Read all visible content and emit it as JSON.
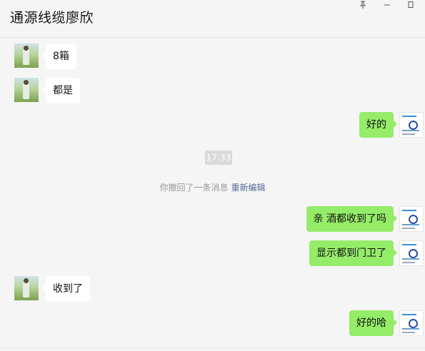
{
  "header": {
    "title": "通源线缆廖欣"
  },
  "window_controls": [
    "pin-icon",
    "minimize-icon",
    "maximize-icon"
  ],
  "messages": [
    {
      "side": "left",
      "text": "8箱"
    },
    {
      "side": "left",
      "text": "都是"
    },
    {
      "side": "right",
      "text": "好的"
    },
    {
      "side": "right",
      "text": "亲 酒都收到了吗"
    },
    {
      "side": "right",
      "text": "显示都到门卫了"
    },
    {
      "side": "left",
      "text": "收到了"
    },
    {
      "side": "right",
      "text": "好的哈"
    }
  ],
  "timestamp": "17:33",
  "recall_notice": {
    "text": "你撤回了一条消息",
    "reedit_label": "重新编辑"
  },
  "colors": {
    "background": "#f5f5f5",
    "bubble_self": "#95ec69",
    "bubble_other": "#ffffff",
    "link": "#576b95"
  }
}
